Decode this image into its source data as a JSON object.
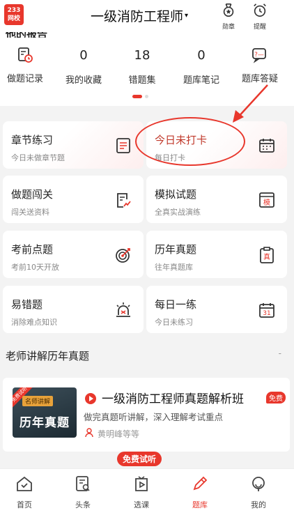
{
  "header": {
    "logo_line1": "233",
    "logo_line2": "网校",
    "title": "一级消防工程师",
    "caret": "▾",
    "badge_label": "勋章",
    "remind_label": "提醒"
  },
  "stats": {
    "partial_title": "他的报告",
    "items": [
      {
        "label": "做题记录",
        "value": "",
        "icon": "clock-document-icon"
      },
      {
        "label": "我的收藏",
        "value": "0"
      },
      {
        "label": "错题集",
        "value": "18"
      },
      {
        "label": "题库笔记",
        "value": "0"
      },
      {
        "label": "题库答疑",
        "value": "",
        "icon": "question-bubble-icon"
      }
    ]
  },
  "grid": [
    {
      "title": "章节练习",
      "sub": "今日未做章节题",
      "icon": "list-document-icon"
    },
    {
      "title": "今日未打卡",
      "sub": "每日打卡",
      "icon": "calendar-icon"
    },
    {
      "title": "做题闯关",
      "sub": "闯关送资料",
      "icon": "chart-document-icon"
    },
    {
      "title": "模拟试题",
      "sub": "全真实战演练",
      "icon": "mock-exam-icon",
      "glyph": "模"
    },
    {
      "title": "考前点题",
      "sub": "考前10天开放",
      "icon": "target-icon"
    },
    {
      "title": "历年真题",
      "sub": "往年真题库",
      "icon": "real-exam-icon",
      "glyph": "真"
    },
    {
      "title": "易错题",
      "sub": "消除难点知识",
      "icon": "alarm-icon"
    },
    {
      "title": "每日一练",
      "sub": "今日未练习",
      "icon": "calendar-31-icon",
      "glyph": "31"
    }
  ],
  "section": {
    "title": "老师讲解历年真题",
    "more": "-"
  },
  "course": {
    "thumb_corner": "免费试听",
    "thumb_tag": "名师讲解",
    "thumb_title": "历年真题",
    "name": "一级消防工程师真题解析班",
    "free_badge": "免费",
    "desc": "做完真题听讲解，深入理解考试重点",
    "teacher": "黄明峰等等"
  },
  "trial_button": "免费试听",
  "nav": [
    {
      "label": "首页",
      "icon": "home-icon"
    },
    {
      "label": "头条",
      "icon": "news-icon"
    },
    {
      "label": "选课",
      "icon": "course-icon"
    },
    {
      "label": "题库",
      "icon": "pencil-icon",
      "active": true
    },
    {
      "label": "我的",
      "icon": "profile-icon"
    }
  ],
  "colors": {
    "accent": "#e8372c",
    "background": "#f3f3f3"
  }
}
